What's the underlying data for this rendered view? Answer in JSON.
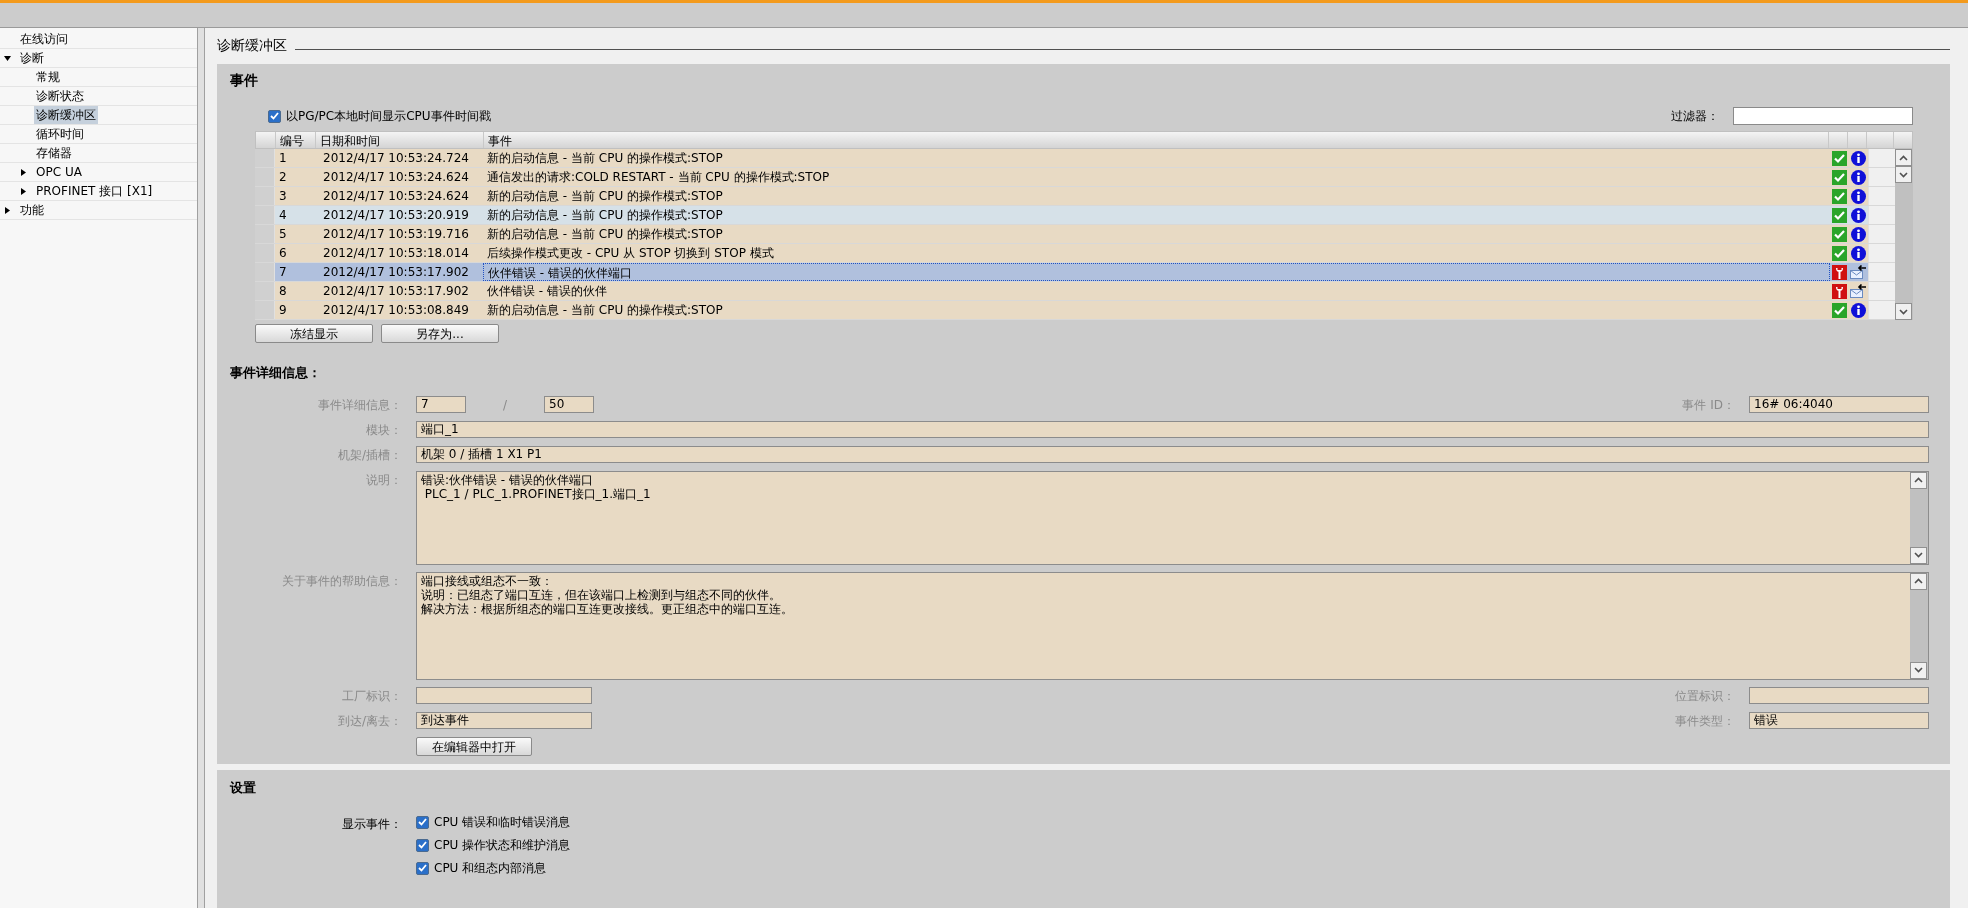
{
  "sidebar": {
    "items": [
      {
        "label": "在线访问",
        "selected": false
      },
      {
        "label": "诊断",
        "expanded": true,
        "selected": false,
        "children": [
          {
            "label": "常规",
            "selected": false
          },
          {
            "label": "诊断状态",
            "selected": false
          },
          {
            "label": "诊断缓冲区",
            "selected": true
          },
          {
            "label": "循环时间",
            "selected": false
          },
          {
            "label": "存储器",
            "selected": false
          },
          {
            "label": "OPC UA",
            "expanded": false,
            "selected": false
          },
          {
            "label": "PROFINET 接口 [X1]",
            "expanded": false,
            "selected": false
          }
        ]
      },
      {
        "label": "功能",
        "expanded": false,
        "selected": false
      }
    ]
  },
  "page_title": "诊断缓冲区",
  "events": {
    "title": "事件",
    "local_time": {
      "label": "以PG/PC本地时间显示CPU事件时间戳",
      "checked": true
    },
    "filter": {
      "label": "过滤器："
    },
    "table": {
      "columns": [
        "编号",
        "日期和时间",
        "事件"
      ],
      "rows": [
        {
          "number": "1",
          "datetime": "2012/4/17 10:53:24.724",
          "event": "新的启动信息 - 当前 CPU 的操作模式:STOP",
          "kind": "ok_info",
          "selected": false,
          "hovered": false
        },
        {
          "number": "2",
          "datetime": "2012/4/17 10:53:24.624",
          "event": "通信发出的请求:COLD RESTART - 当前 CPU 的操作模式:STOP",
          "kind": "ok_info",
          "selected": false,
          "hovered": false
        },
        {
          "number": "3",
          "datetime": "2012/4/17 10:53:24.624",
          "event": "新的启动信息 - 当前 CPU 的操作模式:STOP",
          "kind": "ok_info",
          "selected": false,
          "hovered": false
        },
        {
          "number": "4",
          "datetime": "2012/4/17 10:53:20.919",
          "event": "新的启动信息 - 当前 CPU 的操作模式:STOP",
          "kind": "ok_info",
          "selected": false,
          "hovered": true
        },
        {
          "number": "5",
          "datetime": "2012/4/17 10:53:19.716",
          "event": "新的启动信息 - 当前 CPU 的操作模式:STOP",
          "kind": "ok_info",
          "selected": false,
          "hovered": false
        },
        {
          "number": "6",
          "datetime": "2012/4/17 10:53:18.014",
          "event": "后续操作模式更改 - CPU 从 STOP 切换到 STOP 模式",
          "kind": "ok_info",
          "selected": false,
          "hovered": false
        },
        {
          "number": "7",
          "datetime": "2012/4/17 10:53:17.902",
          "event": "伙伴错误 - 错误的伙伴端口",
          "kind": "fault_message",
          "selected": true,
          "hovered": false
        },
        {
          "number": "8",
          "datetime": "2012/4/17 10:53:17.902",
          "event": "伙伴错误 - 错误的伙伴",
          "kind": "fault_message",
          "selected": false,
          "hovered": false
        },
        {
          "number": "9",
          "datetime": "2012/4/17 10:53:08.849",
          "event": "新的启动信息 - 当前 CPU 的操作模式:STOP",
          "kind": "ok_info",
          "selected": false,
          "hovered": false
        }
      ]
    },
    "buttons": [
      "冻结显示",
      "另存为..."
    ]
  },
  "details": {
    "title": "事件详细信息：",
    "index": {
      "label": "事件详细信息：",
      "value": "7",
      "separator": "/",
      "total": "50"
    },
    "event_id": {
      "label": "事件 ID：",
      "value": "16# 06:4040"
    },
    "module": {
      "label": "模块：",
      "value": "端口_1"
    },
    "rack_slot": {
      "label": "机架/插槽：",
      "value": "机架 0 / 插槽 1 X1 P1"
    },
    "description": {
      "label": "说明：",
      "lines": [
        "错误:伙伴错误 - 错误的伙伴端口",
        " PLC_1 / PLC_1.PROFINET接口_1.端口_1"
      ]
    },
    "help": {
      "label": "关于事件的帮助信息：",
      "lines": [
        "端口接线或组态不一致：",
        "说明：已组态了端口互连，但在该端口上检测到与组态不同的伙伴。",
        "解决方法：根据所组态的端口互连更改接线。更正组态中的端口互连。"
      ]
    },
    "plant_id": {
      "label": "工厂标识："
    },
    "location_id": {
      "label": "位置标识："
    },
    "arrival": {
      "label": "到达/离去：",
      "value": "到达事件"
    },
    "event_type": {
      "label": "事件类型：",
      "value": "错误"
    },
    "open_button": "在编辑器中打开"
  },
  "settings": {
    "title": "设置",
    "show_events": {
      "label": "显示事件：",
      "options": [
        {
          "label": "CPU 错误和临时错误消息",
          "checked": true
        },
        {
          "label": "CPU 操作状态和维护消息",
          "checked": true
        },
        {
          "label": "CPU 和组态内部消息",
          "checked": true
        }
      ]
    }
  }
}
